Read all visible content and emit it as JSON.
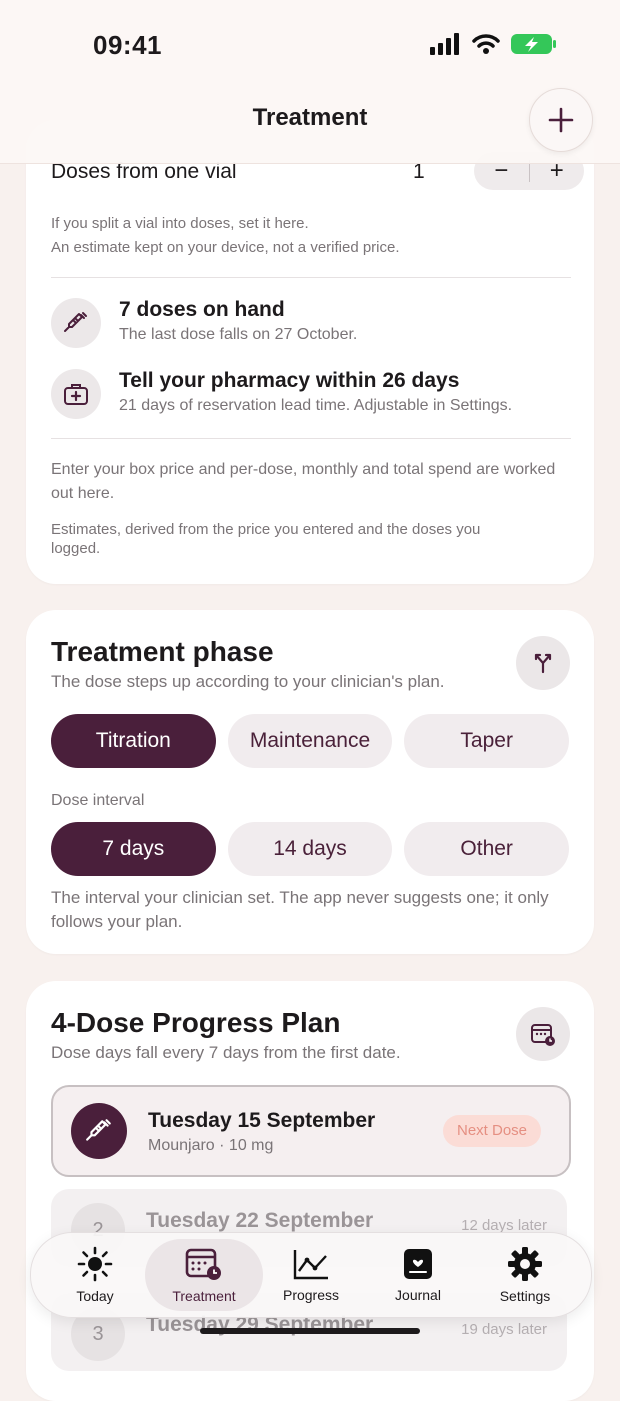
{
  "status_bar": {
    "time": "09:41"
  },
  "header": {
    "title": "Treatment"
  },
  "supply": {
    "vial_label": "Doses from one vial",
    "vial_count": "1",
    "minus": "−",
    "plus": "+",
    "hint1": "If you split a vial into doses, set it here.",
    "hint2": "An estimate kept on your device, not a verified price.",
    "on_hand_title": "7 doses on hand",
    "on_hand_sub": "The last dose falls on 27 October.",
    "pharmacy_title": "Tell your pharmacy within 26 days",
    "pharmacy_sub": "21 days of reservation lead time. Adjustable in Settings.",
    "price_hint": "Enter your box price and per-dose, monthly and total spend are worked out here.",
    "estimate_note": "Estimates, derived from the price you entered and the doses you logged."
  },
  "phase": {
    "title": "Treatment phase",
    "subtitle": "The dose steps up according to your clinician's plan.",
    "options": [
      "Titration",
      "Maintenance",
      "Taper"
    ],
    "selected_option": "Titration",
    "interval_label": "Dose interval",
    "intervals": [
      "7 days",
      "14 days",
      "Other"
    ],
    "selected_interval": "7 days",
    "interval_note": "The interval your clinician set. The app never suggests one; it only follows your plan."
  },
  "plan": {
    "title": "4-Dose Progress Plan",
    "subtitle": "Dose days fall every 7 days from the first date.",
    "next": {
      "date": "Tuesday 15 September",
      "detail": "Mounjaro · 10 mg",
      "badge": "Next Dose"
    },
    "rows": [
      {
        "num": "2",
        "date": "Tuesday 22 September",
        "right": "12 days later"
      },
      {
        "num": "3",
        "date": "Tuesday 29 September",
        "right": "19 days later"
      }
    ]
  },
  "tabs": [
    {
      "label": "Today",
      "icon": "sun-icon"
    },
    {
      "label": "Treatment",
      "icon": "calendar-clock-icon"
    },
    {
      "label": "Progress",
      "icon": "line-chart-icon"
    },
    {
      "label": "Journal",
      "icon": "journal-icon"
    },
    {
      "label": "Settings",
      "icon": "gear-icon"
    }
  ],
  "colors": {
    "accent": "#4a1f3b",
    "badge_bg": "#fbdcd6",
    "badge_text": "#e58f82",
    "background": "#f8f1ee"
  }
}
